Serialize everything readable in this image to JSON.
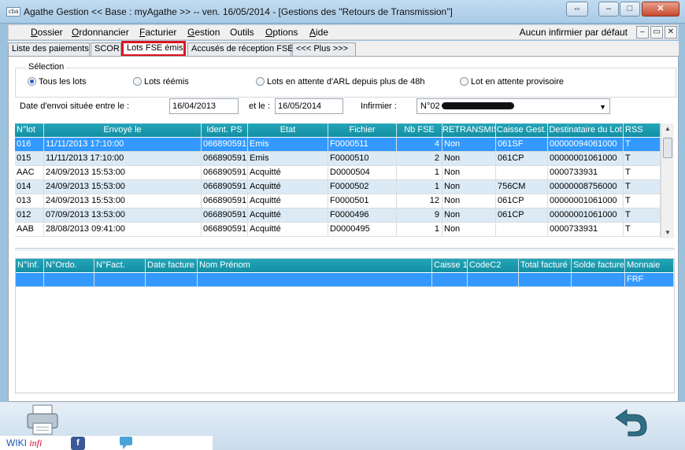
{
  "window": {
    "logo": "cba",
    "title": "Agathe Gestion << Base : myAgathe >>   --   ven. 16/05/2014  - [Gestions des \"Retours de Transmission\"]",
    "controls": [
      "⇔",
      "–",
      "□",
      "✕"
    ]
  },
  "menubar": {
    "items": [
      {
        "key": "D",
        "rest": "ossier"
      },
      {
        "key": "O",
        "rest": "rdonnancier"
      },
      {
        "key": "F",
        "rest": "acturier"
      },
      {
        "key": "G",
        "rest": "estion"
      },
      {
        "key": "",
        "rest": "Outils"
      },
      {
        "key": "O",
        "rest": "ptions"
      },
      {
        "key": "A",
        "rest": "ide"
      }
    ],
    "nurse_default": "Aucun infirmier par défaut",
    "mdi_controls": [
      "–",
      "▭",
      "✕"
    ]
  },
  "tabs": [
    {
      "label": "Liste des paiements",
      "active": false
    },
    {
      "label": "SCOR",
      "active": false
    },
    {
      "label": "Lots FSE émis",
      "active": true
    },
    {
      "label": "Accusés de réception FSE",
      "active": false
    },
    {
      "label": "<<< Plus >>>",
      "active": false
    }
  ],
  "selection": {
    "title": "Sélection",
    "options": [
      {
        "label": "Tous les lots",
        "checked": true
      },
      {
        "label": "Lots réémis",
        "checked": false
      },
      {
        "label": "Lots en attente d'ARL depuis plus de 48h",
        "checked": false
      },
      {
        "label": "Lot en attente provisoire",
        "checked": false
      }
    ]
  },
  "filters": {
    "date_label": "Date d'envoi située entre le :",
    "date_from": "16/04/2013",
    "and_label": "et le :",
    "date_to": "16/05/2014",
    "nurse_label": "Infirmier :",
    "nurse_value": "N°02"
  },
  "lots_grid": {
    "columns": [
      "N°lot",
      "Envoyé le",
      "Ident. PS",
      "Etat",
      "Fichier",
      "Nb FSE",
      "RETRANSMIS",
      "Caisse Gest.",
      "Destinataire du Lot",
      "RSS"
    ],
    "rows": [
      [
        "016",
        "11/11/2013 17:10:00",
        "066890591",
        "Emis",
        "F0000511",
        "4",
        "Non",
        "061SF",
        "00000094061000",
        "T"
      ],
      [
        "015",
        "11/11/2013 17:10:00",
        "066890591",
        "Emis",
        "F0000510",
        "2",
        "Non",
        "061CP",
        "00000001061000",
        "T"
      ],
      [
        "AAC",
        "24/09/2013 15:53:00",
        "066890591",
        "Acquitté",
        "D0000504",
        "1",
        "Non",
        "",
        "0000733931",
        "T"
      ],
      [
        "014",
        "24/09/2013 15:53:00",
        "066890591",
        "Acquitté",
        "F0000502",
        "1",
        "Non",
        "756CM",
        "00000008756000",
        "T"
      ],
      [
        "013",
        "24/09/2013 15:53:00",
        "066890591",
        "Acquitté",
        "F0000501",
        "12",
        "Non",
        "061CP",
        "00000001061000",
        "T"
      ],
      [
        "012",
        "07/09/2013 13:53:00",
        "066890591",
        "Acquitté",
        "F0000496",
        "9",
        "Non",
        "061CP",
        "00000001061000",
        "T"
      ],
      [
        "AAB",
        "28/08/2013 09:41:00",
        "066890591",
        "Acquitté",
        "D0000495",
        "1",
        "Non",
        "",
        "0000733931",
        "T"
      ]
    ],
    "selected_row": 0
  },
  "invoices_grid": {
    "columns": [
      "N°Inf.",
      "N°Ordo.",
      "N°Fact.",
      "Date facture",
      "Nom Prénom",
      "Caisse 1",
      "CodeC2",
      "Total facturé",
      "Solde facture",
      "Monnaie"
    ],
    "rows": [
      [
        "",
        "",
        "",
        "",
        "",
        "",
        "",
        "",
        "",
        "FRF"
      ]
    ]
  },
  "footer": {
    "wiki_label": "WIKI",
    "wiki_suffix": "infi",
    "icons": [
      "printer-icon",
      "return-arrow-icon",
      "facebook-icon",
      "chat-icon"
    ]
  }
}
